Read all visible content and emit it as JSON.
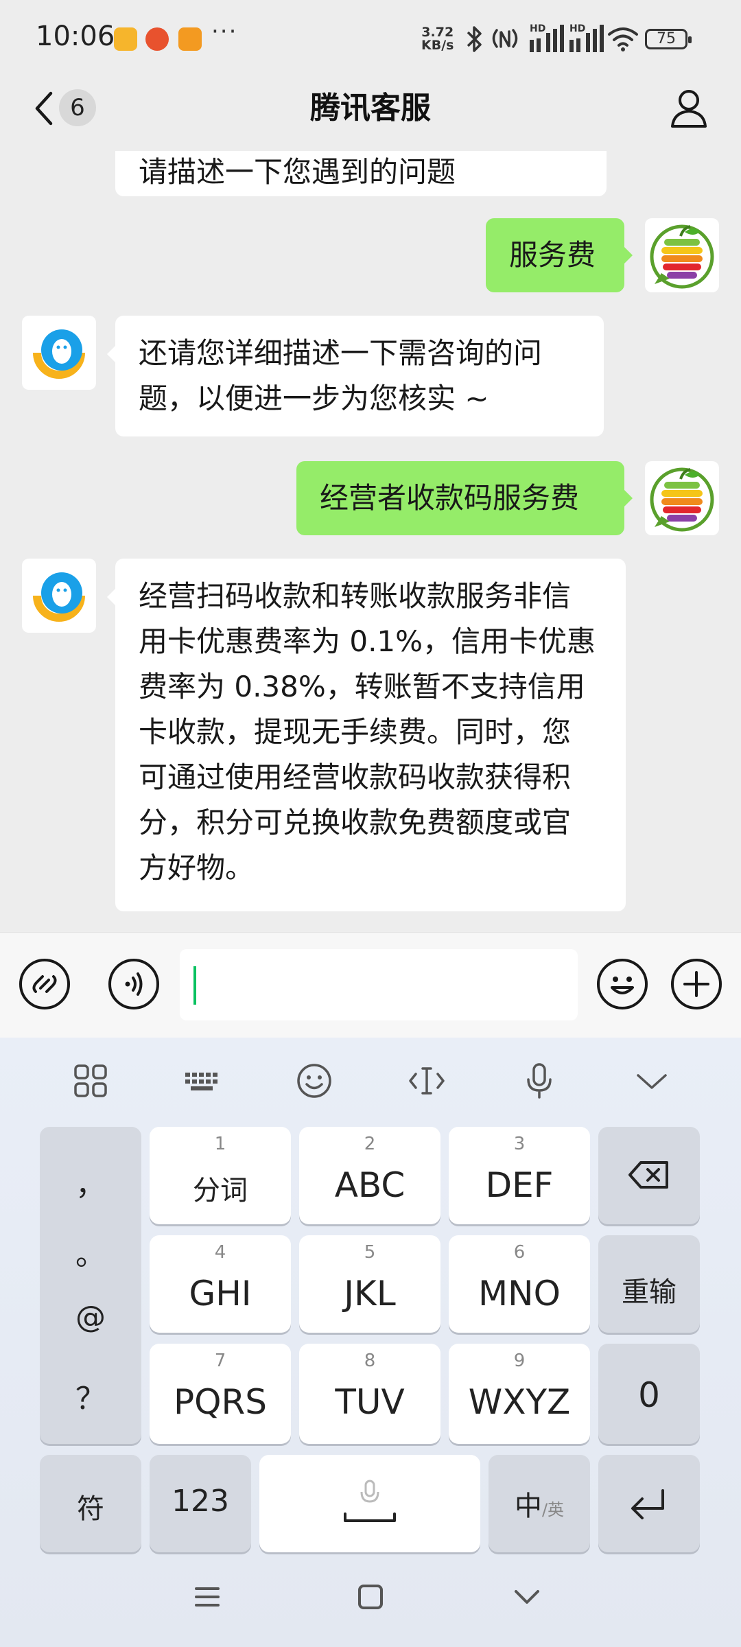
{
  "status_bar": {
    "time": "10:06",
    "more": "···",
    "net_speed_value": "3.72",
    "net_speed_unit": "KB/s",
    "battery": "75",
    "signal1_label": "HD",
    "signal2_label": "HD"
  },
  "header": {
    "unread_count": "6",
    "title": "腾讯客服"
  },
  "messages": [
    {
      "side": "in",
      "text": "请描述一下您遇到的问题"
    },
    {
      "side": "out",
      "text": "服务费"
    },
    {
      "side": "in",
      "lines": [
        "还请您详细描述一下需咨询的问",
        "题，以便进一步为您核实 ~"
      ]
    },
    {
      "side": "out",
      "text": "经营者收款码服务费"
    },
    {
      "side": "in",
      "lines": [
        "经营扫码收款和转账收款服务非信",
        "用卡优惠费率为 0.1%，信用卡优惠",
        "费率为 0.38%，转账暂不支持信用",
        "卡收款，提现无手续费。同时，您",
        "可通过使用经营收款码收款获得积",
        "分，积分可兑换收款免费额度或官",
        "方好物。"
      ]
    }
  ],
  "input": {
    "value": ""
  },
  "keyboard": {
    "toolbar": [
      "apps-icon",
      "keyboard-icon",
      "emoji-icon",
      "cursor-icon",
      "microphone-icon",
      "collapse-icon"
    ],
    "punct_column": [
      "，",
      "。",
      "@",
      "？"
    ],
    "keys": [
      {
        "num": "1",
        "label": "分词"
      },
      {
        "num": "2",
        "label": "ABC"
      },
      {
        "num": "3",
        "label": "DEF"
      },
      {
        "num": "4",
        "label": "GHI"
      },
      {
        "num": "5",
        "label": "JKL"
      },
      {
        "num": "6",
        "label": "MNO"
      },
      {
        "num": "7",
        "label": "PQRS"
      },
      {
        "num": "8",
        "label": "TUV"
      },
      {
        "num": "9",
        "label": "WXYZ"
      }
    ],
    "reinput": "重输",
    "zero": "0",
    "symbols": "符",
    "numbers": "123",
    "lang_main": "中",
    "lang_sub": "/英"
  },
  "colors": {
    "chat_bg": "#ededed",
    "outgoing_bubble": "#95ec69",
    "incoming_bubble": "#ffffff",
    "caret": "#07c160"
  }
}
